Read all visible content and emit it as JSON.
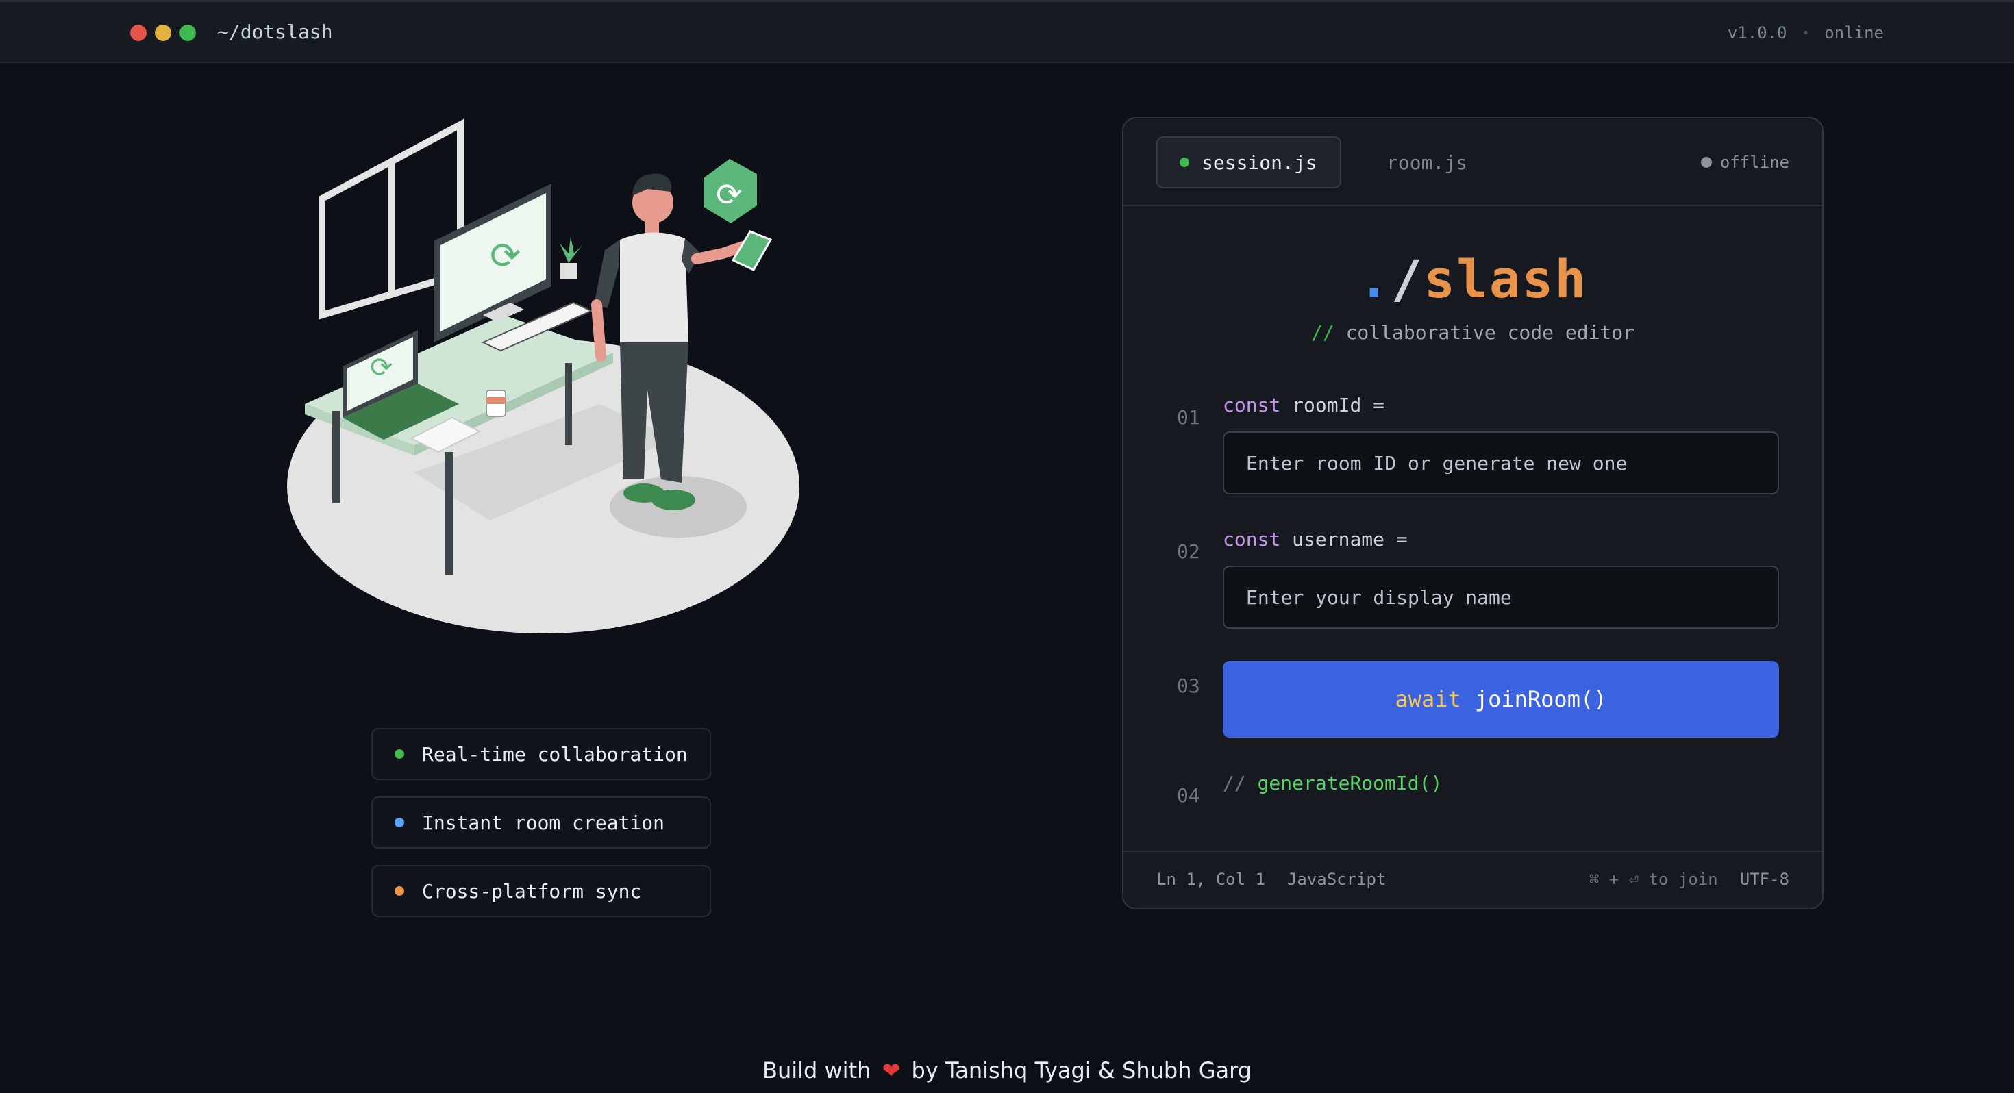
{
  "topbar": {
    "title": "~/dotslash",
    "version": "v1.0.0",
    "separator": "•",
    "connection": "online",
    "window_dots": [
      "#e5534b",
      "#e3b341",
      "#3fb950"
    ]
  },
  "features": [
    {
      "label": "Real-time collaboration",
      "color": "#3fb950"
    },
    {
      "label": "Instant room creation",
      "color": "#58a6ff"
    },
    {
      "label": "Cross-platform sync",
      "color": "#e8924a"
    }
  ],
  "editor": {
    "tabs": {
      "active": "session.js",
      "inactive": "room.js"
    },
    "status": "offline",
    "logo": {
      "dot": ".",
      "slash": "/",
      "name": "slash"
    },
    "tagline": {
      "comment": "//",
      "text": "collaborative code editor"
    },
    "lines": [
      {
        "num": "01",
        "keyword": "const",
        "rest": "roomId ="
      },
      {
        "num": "02",
        "keyword": "const",
        "rest": "username ="
      },
      {
        "num": "03"
      },
      {
        "num": "04",
        "comment": "//",
        "fn": "generateRoomId()"
      }
    ],
    "room_input": {
      "placeholder": "Enter room ID or generate new one"
    },
    "name_input": {
      "placeholder": "Enter your display name"
    },
    "join_button": {
      "await": "await",
      "call": "joinRoom()"
    },
    "footer": {
      "position": "Ln 1, Col 1",
      "language": "JavaScript",
      "hint": "⌘ + ⏎ to join",
      "encoding": "UTF-8"
    }
  },
  "credit": {
    "prefix": "Build with",
    "heart": "❤",
    "suffix": "by Tanishq Tyagi & Shubh Garg"
  },
  "colors": {
    "accent": "#3b63e0",
    "illustration_green": "#5cb87a"
  }
}
